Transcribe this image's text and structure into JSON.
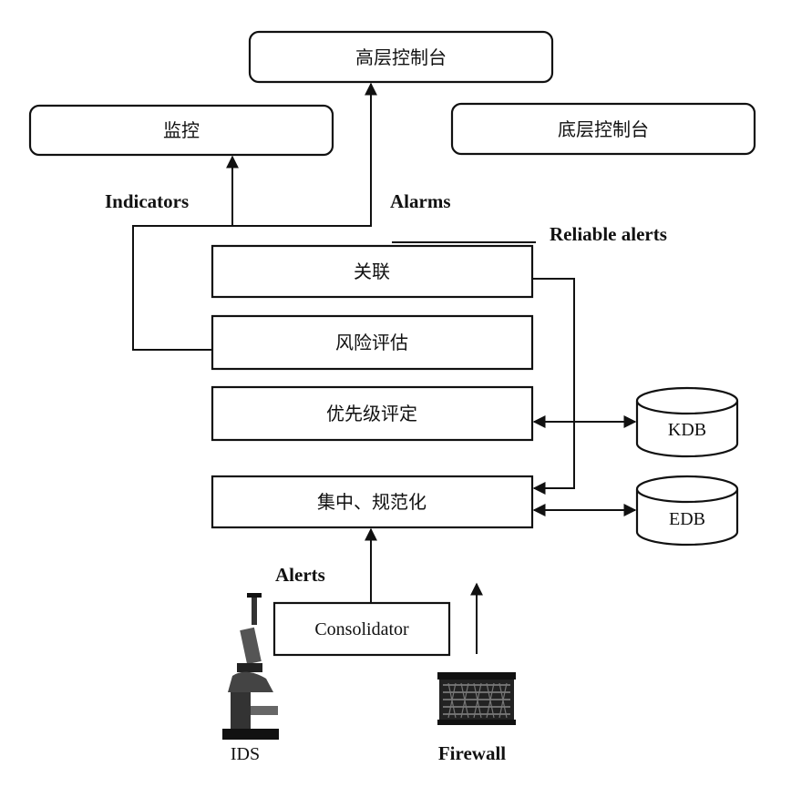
{
  "consoles": {
    "high_level": "高层控制台",
    "monitor": "监控",
    "low_level": "底层控制台"
  },
  "pipeline": {
    "correlation": "关联",
    "risk_assessment": "风险评估",
    "prioritization": "优先级评定",
    "normalization": "集中、规范化"
  },
  "databases": {
    "kdb": "KDB",
    "edb": "EDB"
  },
  "edge_labels": {
    "indicators": "Indicators",
    "alarms": "Alarms",
    "reliable_alerts": "Reliable alerts",
    "alerts": "Alerts"
  },
  "sources": {
    "consolidator": "Consolidator",
    "ids": "IDS",
    "firewall": "Firewall"
  },
  "icons": {
    "ids": "microscope-icon",
    "firewall": "firewall-icon"
  }
}
